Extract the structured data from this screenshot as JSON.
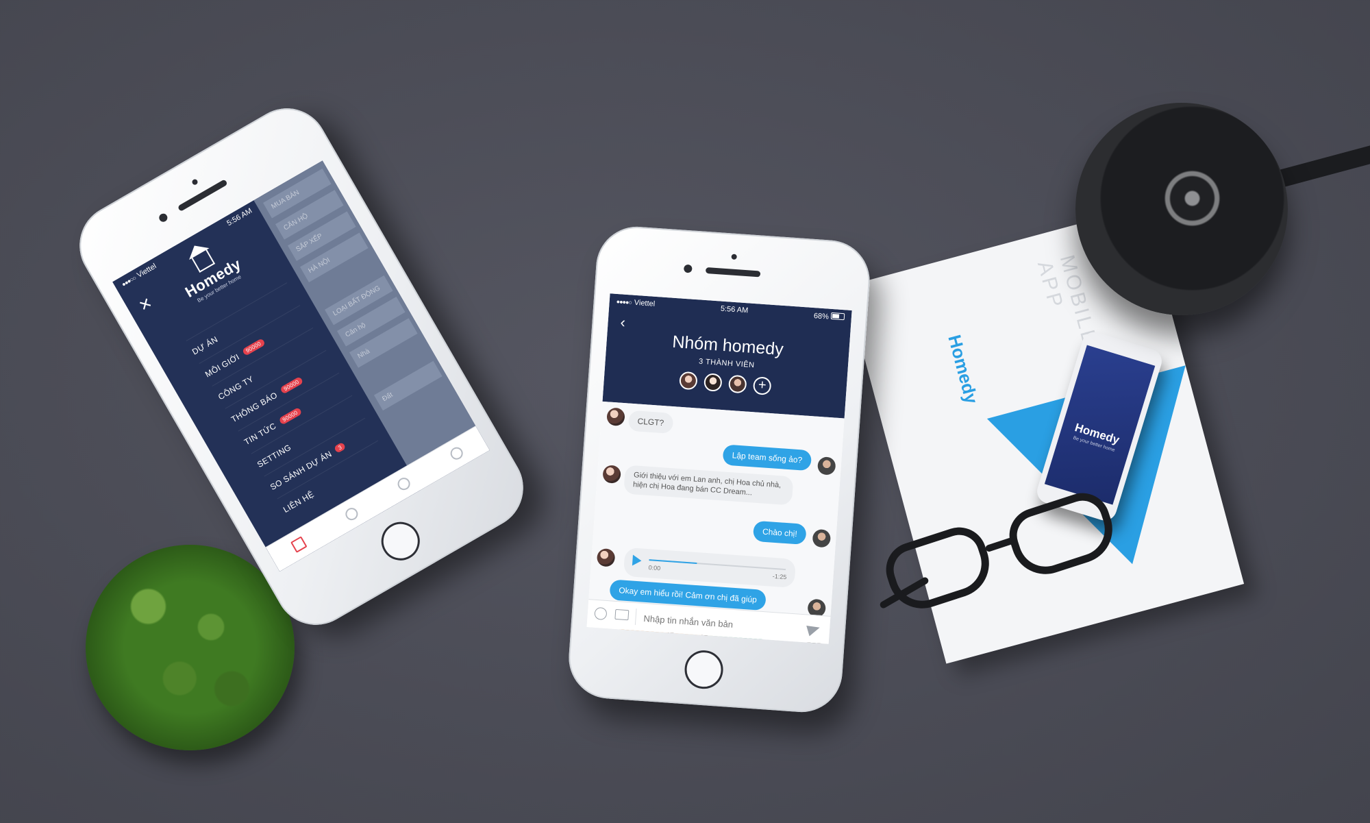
{
  "status": {
    "carrier": "Viettel",
    "time": "5:56 AM",
    "battery": "68%"
  },
  "menu_phone": {
    "logo": {
      "name": "Homedy",
      "tagline": "Be your better home"
    },
    "items": [
      {
        "label": "DỰ ÁN",
        "badge": ""
      },
      {
        "label": "MÔI GIỚI",
        "badge": "90000"
      },
      {
        "label": "CÔNG TY",
        "badge": ""
      },
      {
        "label": "THÔNG BÁO",
        "badge": "90000"
      },
      {
        "label": "TIN TỨC",
        "badge": "90000"
      },
      {
        "label": "SETTING",
        "badge": ""
      },
      {
        "label": "SO SÁNH DỰ ÁN",
        "badge": "3"
      },
      {
        "label": "LIÊN HỆ",
        "badge": ""
      }
    ],
    "behind": {
      "header": "MUA BÁN",
      "tab": "CĂN HỘ",
      "sort": "SẮP XẾP",
      "location": "HÀ NỘI",
      "filter": "LOẠI BẤT ĐỘNG",
      "type1": "Căn hộ",
      "type2": "Nhà",
      "type3": "Đất"
    }
  },
  "chat_phone": {
    "title": "Nhóm homedy",
    "subtitle": "3 THÀNH VIÊN",
    "messages": [
      {
        "side": "in",
        "text": "CLGT?"
      },
      {
        "side": "out",
        "text": "Lập team sống ảo?"
      },
      {
        "side": "in",
        "text": "Giới thiệu với em Lan anh, chị Hoa chủ nhà, hiện chị Hoa đang bán CC Dream..."
      },
      {
        "side": "out",
        "text": "Chào chị!"
      },
      {
        "side": "out",
        "text": "Okay em hiểu rồi! Cảm ơn chị đã giúp"
      }
    ],
    "audio": {
      "start": "0:00",
      "end": "-1:25",
      "progress": 0.35
    },
    "input_placeholder": "Nhập tin nhắn văn bản"
  },
  "desk": {
    "paper_logo": "Homedy",
    "paper_tagline": "Be your better home",
    "paper_text": "MOBILE APP",
    "mini_logo": "Homedy",
    "mini_tagline": "Be your better home"
  },
  "colors": {
    "navy": "#1f2d53",
    "accent": "#2fa3e6",
    "badge": "#e5424d",
    "background": "#4b4c56"
  }
}
